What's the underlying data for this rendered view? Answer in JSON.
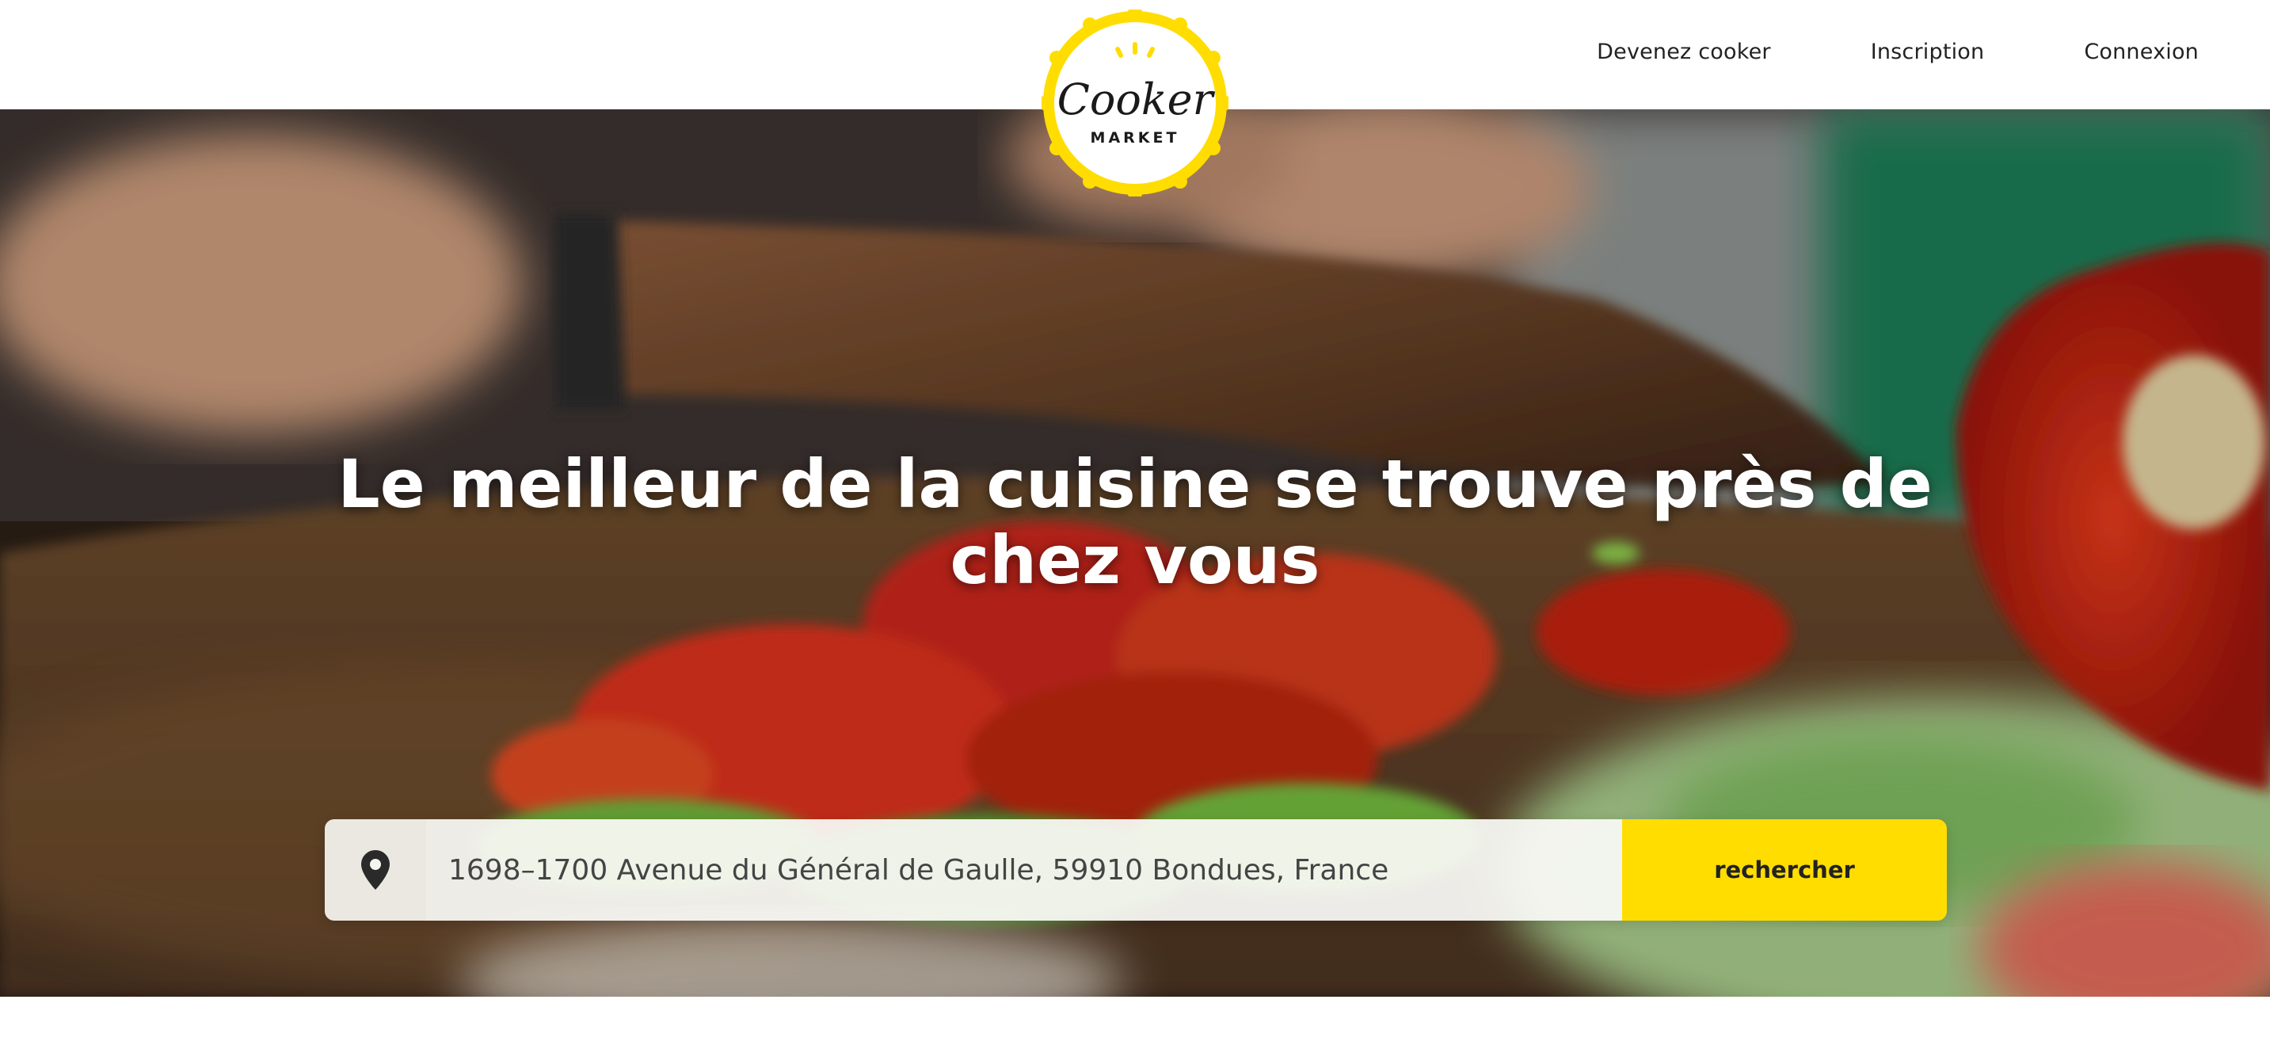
{
  "header": {
    "logo_word": "Cooker",
    "logo_sub": "MARKET",
    "nav": [
      {
        "label": "Devenez cooker"
      },
      {
        "label": "Inscription"
      },
      {
        "label": "Connexion"
      }
    ]
  },
  "hero": {
    "headline_line1": "Le meilleur de la cuisine se trouve près de",
    "headline_line2": "chez vous"
  },
  "search": {
    "address_value": "1698–1700 Avenue du Général de Gaulle, 59910 Bondues, France",
    "button_label": "rechercher"
  },
  "colors": {
    "accent": "#ffdd00",
    "text": "#222222"
  },
  "icons": [
    "location-pin-icon"
  ]
}
